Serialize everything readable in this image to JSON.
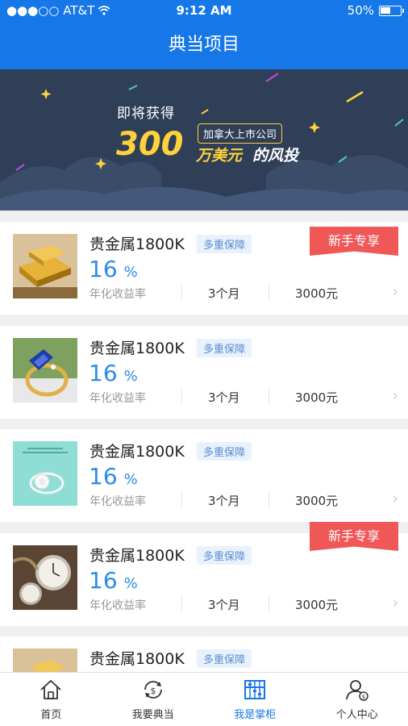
{
  "status": {
    "carrier": "●●●○○ AT&T",
    "time": "9:12 AM",
    "battery": "50%"
  },
  "header": {
    "title": "典当项目"
  },
  "banner": {
    "line1": "即将获得",
    "tag": "加拿大上市公司",
    "amount": "300",
    "unit": "万美元",
    "suffix": "的风投"
  },
  "products": [
    {
      "title": "贵金属1800K",
      "tag": "多重保障",
      "rate": "16",
      "rate_unit": "%",
      "rate_label": "年化收益率",
      "term": "3个月",
      "amount": "3000元",
      "badge": "新手专享",
      "image": "gold-bars"
    },
    {
      "title": "贵金属1800K",
      "tag": "多重保障",
      "rate": "16",
      "rate_unit": "%",
      "rate_label": "年化收益率",
      "term": "3个月",
      "amount": "3000元",
      "badge": "",
      "image": "sapphire-ring"
    },
    {
      "title": "贵金属1800K",
      "tag": "多重保障",
      "rate": "16",
      "rate_unit": "%",
      "rate_label": "年化收益率",
      "term": "3个月",
      "amount": "3000元",
      "badge": "",
      "image": "diamond-ring"
    },
    {
      "title": "贵金属1800K",
      "tag": "多重保障",
      "rate": "16",
      "rate_unit": "%",
      "rate_label": "年化收益率",
      "term": "3个月",
      "amount": "3000元",
      "badge": "新手专享",
      "image": "pocket-watches"
    },
    {
      "title": "贵金属1800K",
      "tag": "多重保障",
      "image": "gold-bars"
    }
  ],
  "tabs": [
    {
      "label": "首页",
      "icon": "home-icon"
    },
    {
      "label": "我要典当",
      "icon": "pawn-icon"
    },
    {
      "label": "我是掌柜",
      "icon": "abacus-icon",
      "active": true
    },
    {
      "label": "个人中心",
      "icon": "user-icon"
    }
  ],
  "colors": {
    "primary": "#1677e8",
    "accent": "#f05858",
    "banner": "#2f3f58",
    "gold": "#ffd23a"
  }
}
